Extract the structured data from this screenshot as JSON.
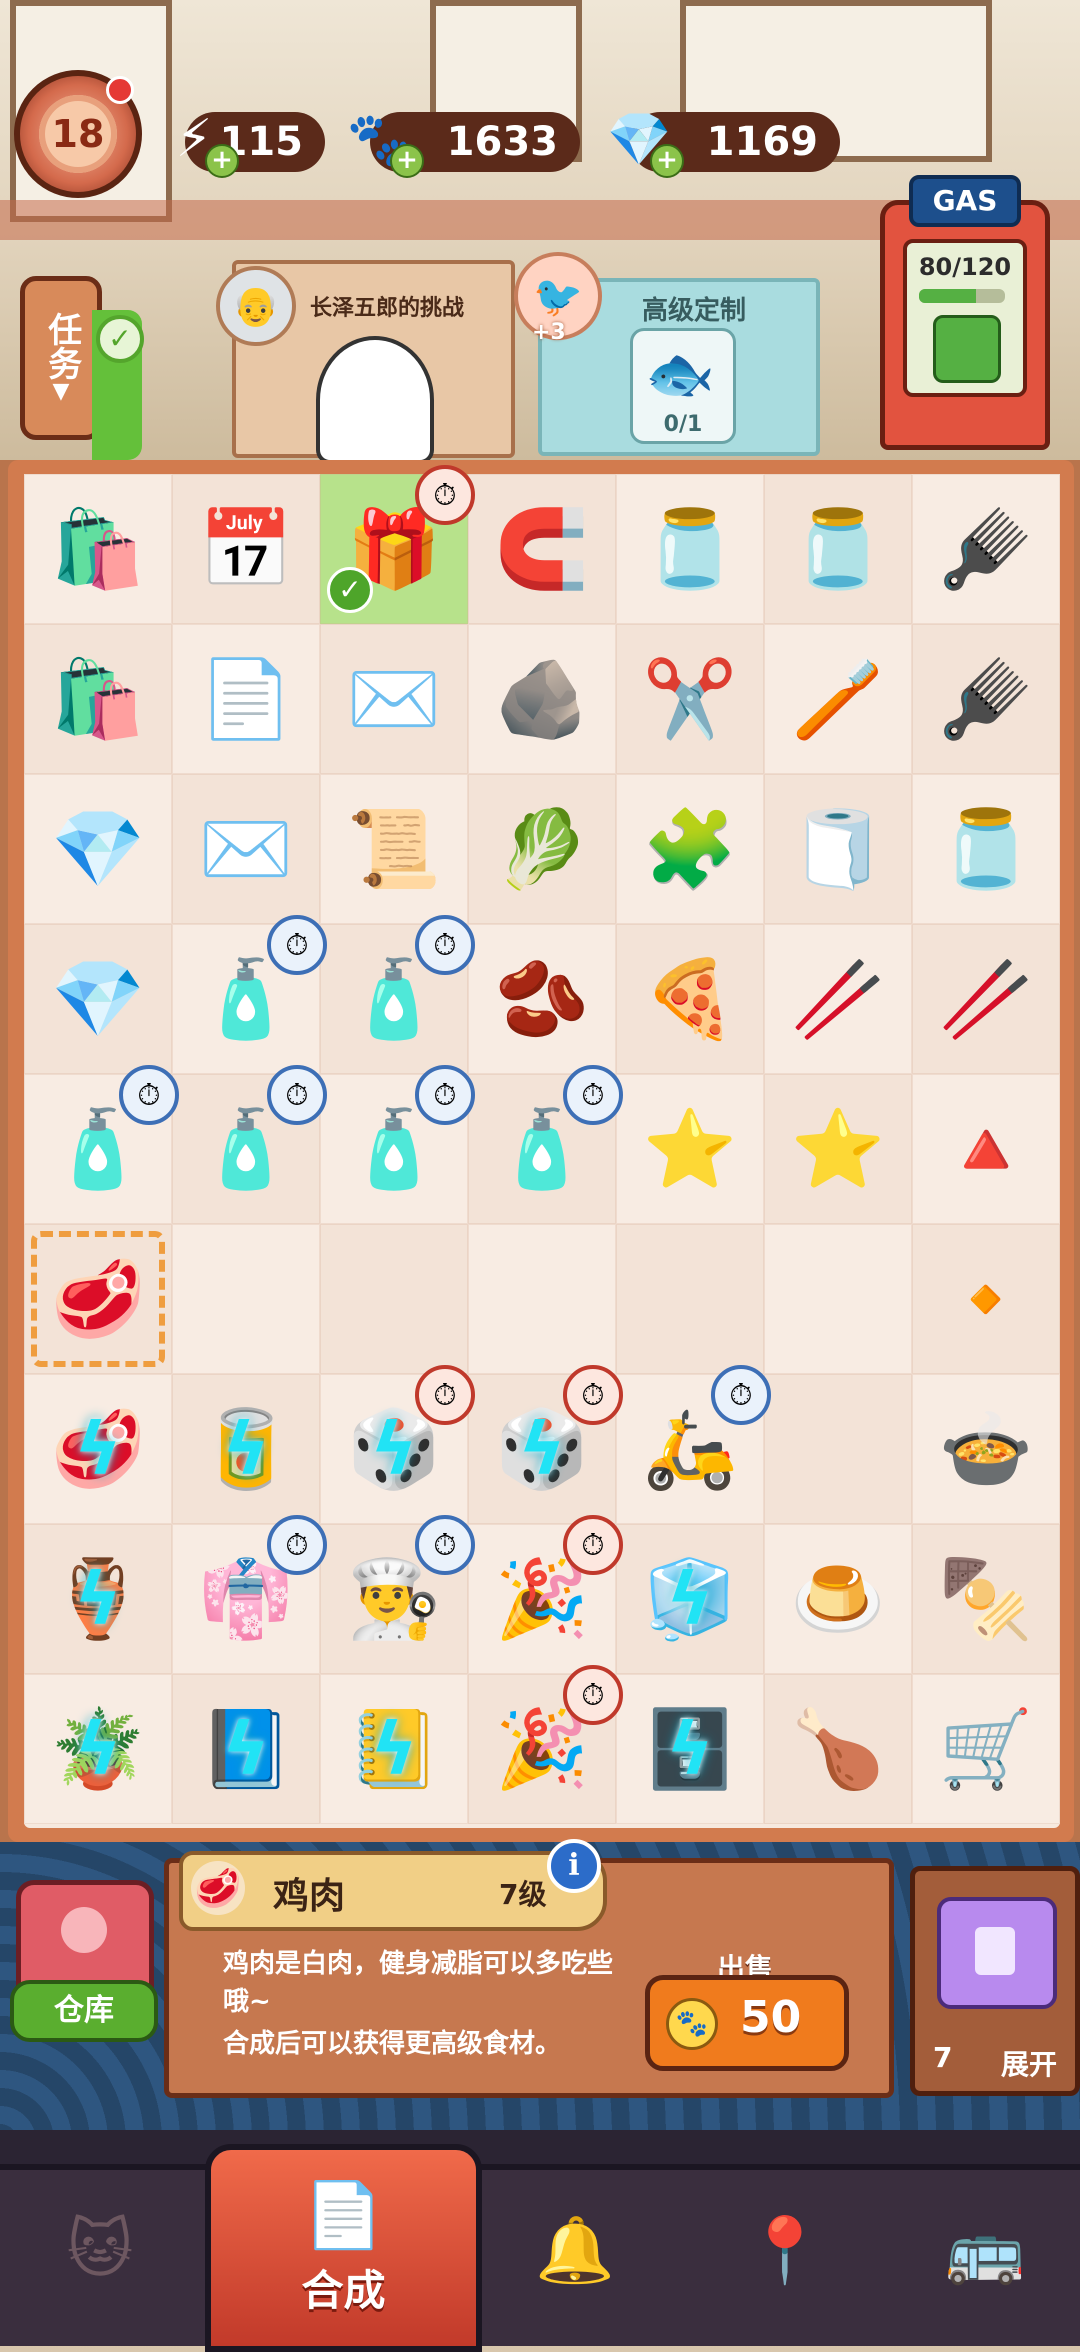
{
  "hud": {
    "level": "18",
    "energy": "115",
    "paws": "1633",
    "gems": "1169"
  },
  "tasks": {
    "task_tab": "任务",
    "challenge_title": "长泽五郎的挑战",
    "custom_title": "高级定制",
    "custom_bonus": "+3",
    "custom_progress": "0/1"
  },
  "gas": {
    "label": "GAS",
    "value": "80/120",
    "fill": 0.667
  },
  "board": {
    "cells": [
      {
        "icon": "🛍️",
        "name": "paper-bag"
      },
      {
        "icon": "📅",
        "name": "calendar"
      },
      {
        "icon": "🎁",
        "name": "gift-box",
        "timer": "red",
        "check": true,
        "highlight": true
      },
      {
        "icon": "🧲",
        "name": "green-tool"
      },
      {
        "icon": "🫙",
        "name": "teal-jar"
      },
      {
        "icon": "🫙",
        "name": "teal-jar"
      },
      {
        "icon": "🪮",
        "name": "pink-razor"
      },
      {
        "icon": "🛍️",
        "name": "paper-bag"
      },
      {
        "icon": "📄",
        "name": "folded-paper"
      },
      {
        "icon": "✉️",
        "name": "paper-plane"
      },
      {
        "icon": "🪨",
        "name": "crumpled-paper"
      },
      {
        "icon": "✂️",
        "name": "scissors"
      },
      {
        "icon": "🪥",
        "name": "brush"
      },
      {
        "icon": "🪮",
        "name": "pink-razor"
      },
      {
        "icon": "💎",
        "name": "blue-gems"
      },
      {
        "icon": "✉️",
        "name": "envelope"
      },
      {
        "icon": "📜",
        "name": "paper-sheet"
      },
      {
        "icon": "🥬",
        "name": "seaweed-tray"
      },
      {
        "icon": "🧩",
        "name": "puzzle-pieces"
      },
      {
        "icon": "🧻",
        "name": "towel"
      },
      {
        "icon": "🫙",
        "name": "glass-bowl"
      },
      {
        "icon": "💎",
        "name": "blue-gems-large"
      },
      {
        "icon": "🧴",
        "name": "ink-bottle",
        "timer": "blue"
      },
      {
        "icon": "🧴",
        "name": "ink-bottle",
        "timer": "blue"
      },
      {
        "icon": "🫘",
        "name": "rice-sack"
      },
      {
        "icon": "🍕",
        "name": "okonomiyaki"
      },
      {
        "icon": "🥢",
        "name": "roll-sprout"
      },
      {
        "icon": "🥢",
        "name": "roll"
      },
      {
        "icon": "🧴",
        "name": "ink-bottle",
        "timer": "blue"
      },
      {
        "icon": "🧴",
        "name": "ink-bottle",
        "timer": "blue"
      },
      {
        "icon": "🧴",
        "name": "ink-bottle",
        "timer": "blue"
      },
      {
        "icon": "🧴",
        "name": "ink-bottle",
        "timer": "blue"
      },
      {
        "icon": "⭐",
        "name": "orange-star"
      },
      {
        "icon": "⭐",
        "name": "orange-star"
      },
      {
        "icon": "🔺",
        "name": "orange-triangle"
      },
      {
        "icon": "🥩",
        "name": "chicken-meat",
        "selected": true
      },
      {
        "icon": "",
        "name": "empty"
      },
      {
        "icon": "",
        "name": "empty"
      },
      {
        "icon": "",
        "name": "empty"
      },
      {
        "icon": "",
        "name": "empty"
      },
      {
        "icon": "",
        "name": "empty"
      },
      {
        "icon": "🔸",
        "name": "orange-diamond"
      },
      {
        "icon": "🥩",
        "name": "meatball",
        "locked": true
      },
      {
        "icon": "🥫",
        "name": "can",
        "locked": true
      },
      {
        "icon": "🎲",
        "name": "rolls",
        "timer": "red",
        "locked": true
      },
      {
        "icon": "🎲",
        "name": "rolls",
        "timer": "red",
        "locked": true
      },
      {
        "icon": "🛵",
        "name": "delivery-scooter",
        "timer": "blue"
      },
      {
        "icon": "",
        "name": "empty"
      },
      {
        "icon": "🍲",
        "name": "hot-pot"
      },
      {
        "icon": "🏺",
        "name": "pot-sticks",
        "locked": true
      },
      {
        "icon": "👘",
        "name": "chef-jacket",
        "timer": "blue"
      },
      {
        "icon": "👨‍🍳",
        "name": "chef-hat",
        "timer": "blue"
      },
      {
        "icon": "🎉",
        "name": "party-hat",
        "timer": "red"
      },
      {
        "icon": "🧊",
        "name": "fridge-shelf",
        "locked": true
      },
      {
        "icon": "🍮",
        "name": "pudding-bowl"
      },
      {
        "icon": "🍢",
        "name": "skewers"
      },
      {
        "icon": "🪴",
        "name": "plant",
        "locked": true
      },
      {
        "icon": "📘",
        "name": "notebook",
        "locked": true
      },
      {
        "icon": "📒",
        "name": "notepad",
        "locked": true
      },
      {
        "icon": "🎉",
        "name": "party-hat",
        "timer": "red"
      },
      {
        "icon": "🗄️",
        "name": "fridge",
        "locked": true
      },
      {
        "icon": "🍗",
        "name": "roast-plate"
      },
      {
        "icon": "🛒",
        "name": "hand-cart"
      }
    ]
  },
  "info": {
    "item_icon": "🥩",
    "item_name": "鸡肉",
    "item_level": "7级",
    "desc1": "鸡肉是白肉，健身减脂可以多吃些哦~",
    "desc2": "合成后可以获得更高级食材。",
    "sell_label": "出售",
    "sell_price": "50",
    "info_btn": "i"
  },
  "warehouse": {
    "label": "仓库"
  },
  "expand": {
    "count": "7",
    "label": "展开"
  },
  "nav": {
    "active_label": "合成",
    "icons": [
      "🐱",
      "🔔",
      "📍",
      "🚌"
    ]
  }
}
